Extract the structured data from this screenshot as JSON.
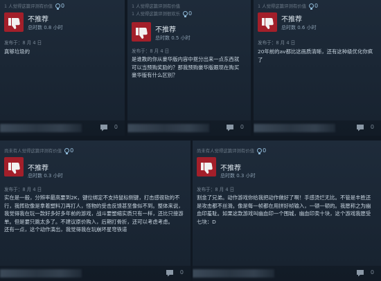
{
  "reviews": [
    {
      "helpful": "1 人觉得这篇评测有价值",
      "awards": "0",
      "verdict": "不推荐",
      "hours": "总时数 0.8 小时",
      "date": "发布于：8 月 4 日",
      "body": "真够垃圾的",
      "comments": "0"
    },
    {
      "helpful_first": "1 人觉得这篇评测有价值",
      "helpful": "1 人觉得这篇评测很欢乐",
      "awards": "0",
      "verdict": "不推荐",
      "hours": "总时数 0.5 小时",
      "date": "发布于：8 月 4 日",
      "body": "是谁教的你从豪华版内容中抠分出来一点东西就可以当预购奖励的？那我预购豪华版跟现在购买豪华版有什么区别？",
      "comments": "0"
    },
    {
      "helpful": "1 人觉得这篇评测有价值",
      "awards": "0",
      "verdict": "不推荐",
      "hours": "总时数 0.6 小时",
      "date": "发布于：8 月 4 日",
      "body": "20年前的av都比这画质清晰，还有这种级优化你疯了",
      "comments": "0"
    },
    {
      "helpful": "尚未有人觉得这篇评测有价值",
      "awards": "0",
      "verdict": "不推荐",
      "hours": "总时数 0.3 小时",
      "date": "发布于：8 月 4 日",
      "body": "实在是一般，分辨率最高要到2K，键位绑定不支持鼠标侧键，打击感很软的不行，我挥砍像是拿着塑料刀再打人，怪物的受击反馈甚至像似不到。整体来说，我觉得我在玩一款好多好多年前的游戏，战斗要塑缩实质只有一样，还比只接游单。但是要只跳太多了。不建议原价购入，后期打骨折，还可以考虑考虑。\n还有一点，这个动作演出，我觉得我在玩崩坏星穹铁道",
      "comments": "0"
    },
    {
      "helpful": "尚未有人觉得这篇评测有价值",
      "awards": "0",
      "verdict": "不推荐",
      "hours": "总时数 0.3 小时",
      "date": "发布于：8 月 4 日",
      "body": "割韭了兄弟。动作游戏你给我把动作做好了啊！手感烫烂无比。不管是丰胜还是攻击都不丝滑。像是每一帧都在用拼好帧输入，一顿一顿的。我愿称之为幽血印羞耻。如果这款游戏叫幽血印一个围城，幽血印卖十块，这个游戏我愿受七块：D",
      "comments": "0"
    }
  ]
}
